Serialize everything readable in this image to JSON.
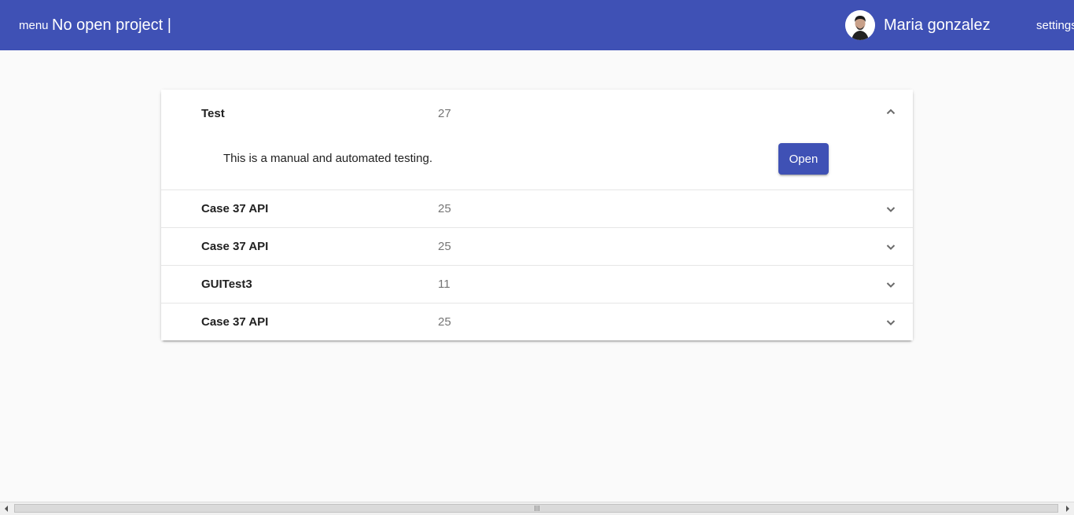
{
  "toolbar": {
    "menu_label": "menu",
    "project_title": "No open project |",
    "user_name": "Maria gonzalez",
    "settings_label": "settings",
    "background_color": "#3f51b5"
  },
  "projects": [
    {
      "name": "Test",
      "count": "27",
      "expanded": true,
      "description": "This is a manual and automated testing.",
      "open_label": "Open"
    },
    {
      "name": "Case 37 API",
      "count": "25",
      "expanded": false
    },
    {
      "name": "Case 37 API",
      "count": "25",
      "expanded": false
    },
    {
      "name": "GUITest3",
      "count": "11",
      "expanded": false
    },
    {
      "name": "Case 37 API",
      "count": "25",
      "expanded": false
    }
  ],
  "icons": {
    "avatar": "user-avatar",
    "expanded": "chevron-up-icon",
    "collapsed": "chevron-down-icon"
  },
  "colors": {
    "accent": "#3f51b5",
    "page_background": "#fafafa"
  }
}
